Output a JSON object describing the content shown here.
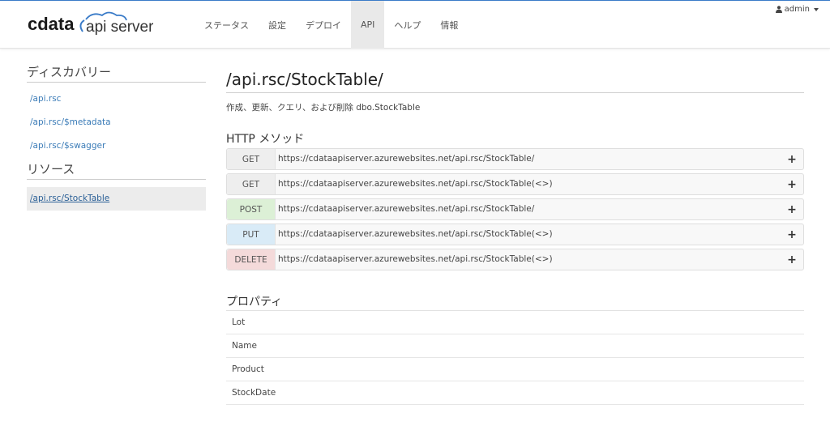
{
  "app": {
    "logo_cdata": "cdata",
    "logo_product": "api server"
  },
  "nav": {
    "items": [
      {
        "label": "ステータス"
      },
      {
        "label": "設定"
      },
      {
        "label": "デプロイ"
      },
      {
        "label": "API"
      },
      {
        "label": "ヘルプ"
      },
      {
        "label": "情報"
      }
    ],
    "active": "API"
  },
  "user": {
    "name": "admin",
    "icon": "user-icon"
  },
  "sidebar": {
    "discovery_heading": "ディスカバリー",
    "discovery_links": [
      {
        "label": "/api.rsc"
      },
      {
        "label": "/api.rsc/$metadata"
      },
      {
        "label": "/api.rsc/$swagger"
      }
    ],
    "resources_heading": "リソース",
    "resource_links": [
      {
        "label": "/api.rsc/StockTable"
      }
    ]
  },
  "main": {
    "title": "/api.rsc/StockTable/",
    "description": "作成、更新、クエリ、および削除 dbo.StockTable",
    "methods_heading": "HTTP メソッド",
    "methods": [
      {
        "method": "GET",
        "url": "https://cdataapiserver.azurewebsites.net/api.rsc/StockTable/",
        "expand": "+"
      },
      {
        "method": "GET",
        "url": "https://cdataapiserver.azurewebsites.net/api.rsc/StockTable(<>)",
        "expand": "+"
      },
      {
        "method": "POST",
        "url": "https://cdataapiserver.azurewebsites.net/api.rsc/StockTable/",
        "expand": "+"
      },
      {
        "method": "PUT",
        "url": "https://cdataapiserver.azurewebsites.net/api.rsc/StockTable(<>)",
        "expand": "+"
      },
      {
        "method": "DELETE",
        "url": "https://cdataapiserver.azurewebsites.net/api.rsc/StockTable(<>)",
        "expand": "+"
      }
    ],
    "properties_heading": "プロパティ",
    "properties": [
      "Lot",
      "Name",
      "Product",
      "StockDate"
    ]
  },
  "colors": {
    "accent": "#3a7bc8",
    "link": "#3a7bb7",
    "get": "#eeeeee",
    "post": "#dcf0d6",
    "put": "#d9ebf7",
    "delete": "#f4dada"
  }
}
